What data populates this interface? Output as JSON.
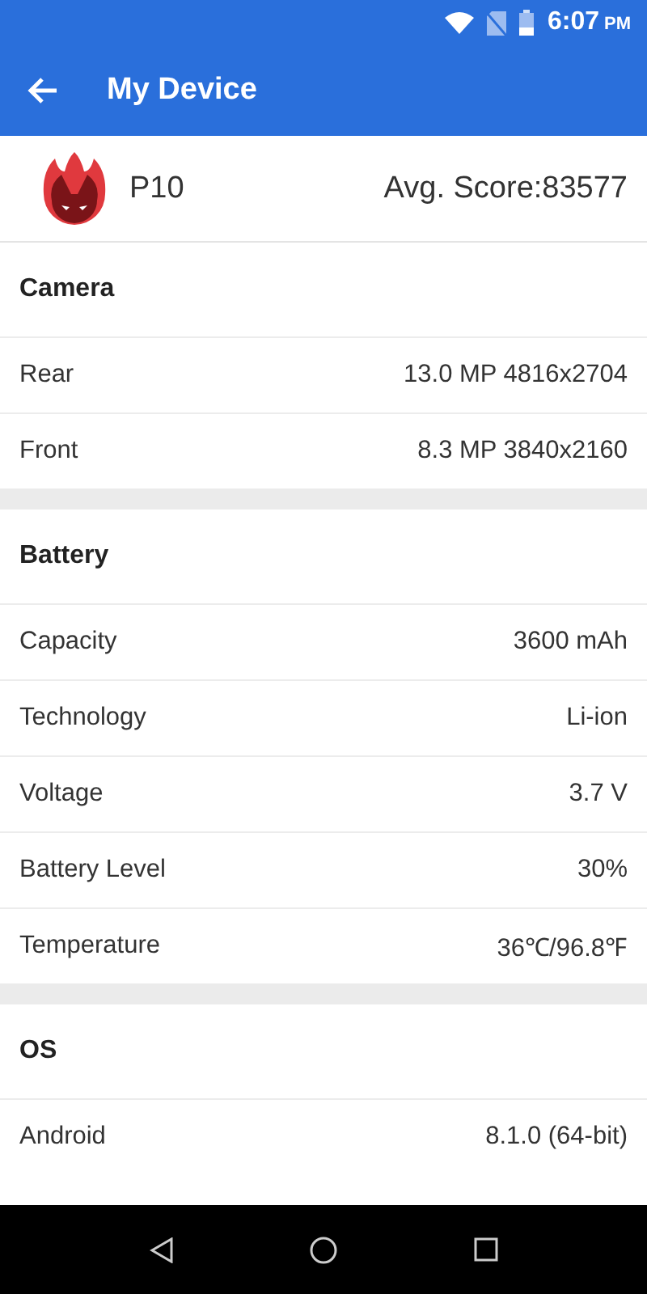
{
  "status_bar": {
    "time": "6:07",
    "meridiem": "PM"
  },
  "app_bar": {
    "title": "My Device"
  },
  "device": {
    "name": "P10",
    "score": "Avg. Score:83577"
  },
  "sections": [
    {
      "title": "Camera",
      "rows": [
        {
          "label": "Rear",
          "value": "13.0 MP 4816x2704"
        },
        {
          "label": "Front",
          "value": "8.3 MP 3840x2160"
        }
      ]
    },
    {
      "title": "Battery",
      "rows": [
        {
          "label": "Capacity",
          "value": "3600 mAh"
        },
        {
          "label": "Technology",
          "value": "Li-ion"
        },
        {
          "label": "Voltage",
          "value": "3.7 V"
        },
        {
          "label": "Battery Level",
          "value": "30%"
        },
        {
          "label": "Temperature",
          "value": "36℃/96.8℉"
        }
      ]
    },
    {
      "title": "OS",
      "rows": [
        {
          "label": "Android",
          "value": "8.1.0 (64-bit)"
        }
      ]
    }
  ]
}
